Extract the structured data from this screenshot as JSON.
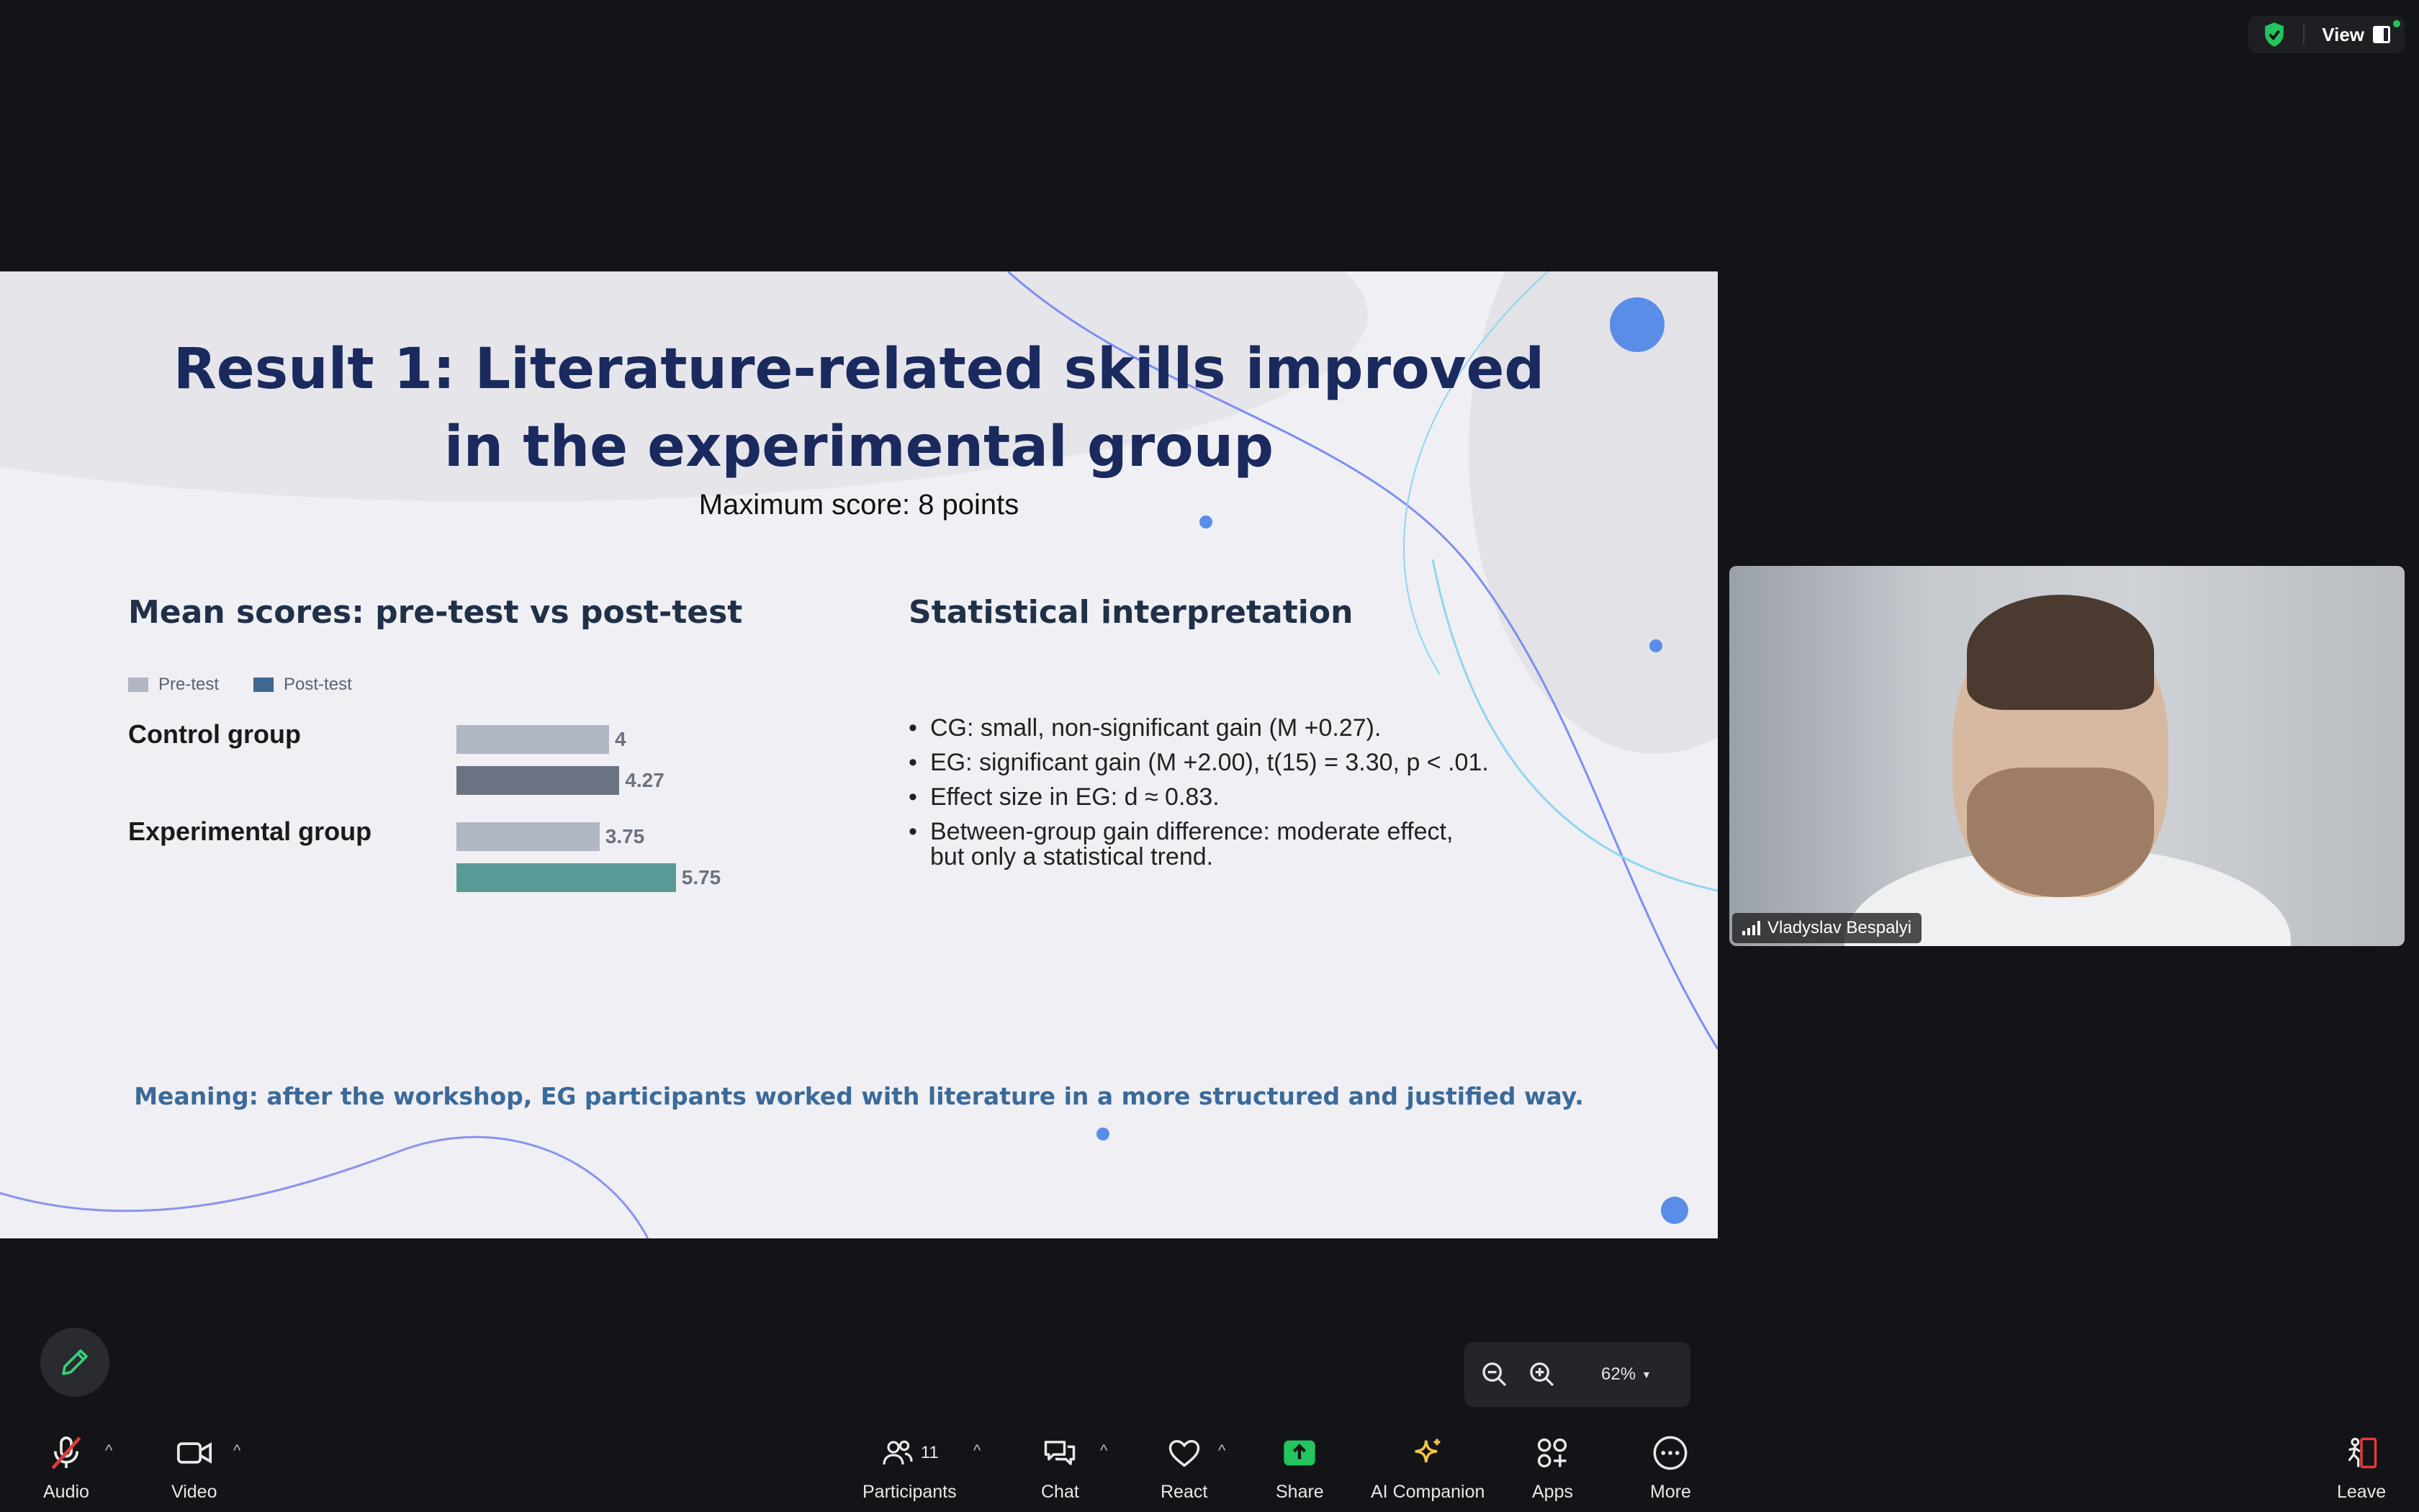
{
  "topbar": {
    "view_label": "View"
  },
  "slide": {
    "title_line1": "Result 1: Literature-related skills improved",
    "title_line2": "in the experimental group",
    "subtitle": "Maximum score: 8 points",
    "left_heading": "Mean scores: pre-test vs post-test",
    "right_heading": "Statistical interpretation",
    "bullets": [
      "CG: small, non-significant gain (M +0.27).",
      "EG: significant gain (M +2.00), t(15) = 3.30, p < .01.",
      "Effect size in EG: d ≈ 0.83.",
      "Between-group gain difference: moderate effect,",
      "but only a statistical trend."
    ],
    "meaning": "Meaning: after the workshop, EG participants worked with literature in a more structured and justified way."
  },
  "chart_data": {
    "type": "bar",
    "orientation": "horizontal",
    "title": "Mean scores: pre-test vs post-test",
    "categories": [
      "Control group",
      "Experimental group"
    ],
    "series": [
      {
        "name": "Pre-test",
        "values": [
          4,
          3.75
        ],
        "labels": [
          "4",
          "3.75"
        ]
      },
      {
        "name": "Post-test",
        "values": [
          4.27,
          5.75
        ],
        "labels": [
          "4.27",
          "5.75"
        ]
      }
    ],
    "xlim": [
      0,
      8
    ],
    "colors": {
      "pre": "#b0b6c3",
      "post_control": "#6b7382",
      "post_experimental": "#5a9a96",
      "legend_post": "#3f6790"
    },
    "legend": "top-left"
  },
  "video": {
    "participant_name": "Vladyslav Bespalyi"
  },
  "zoom": {
    "level": "62%"
  },
  "toolbar": {
    "audio": "Audio",
    "video": "Video",
    "participants": "Participants",
    "participants_count": "11",
    "chat": "Chat",
    "react": "React",
    "share": "Share",
    "ai_companion": "AI Companion",
    "apps": "Apps",
    "more": "More",
    "leave": "Leave"
  }
}
